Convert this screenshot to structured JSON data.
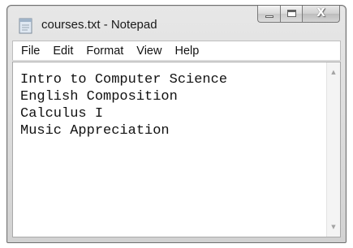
{
  "window": {
    "title": "courses.txt - Notepad",
    "close_glyph": "X"
  },
  "menu": {
    "items": [
      "File",
      "Edit",
      "Format",
      "View",
      "Help"
    ]
  },
  "editor": {
    "lines": [
      "Intro to Computer Science",
      "English Composition",
      "Calculus I",
      "Music Appreciation"
    ]
  },
  "scrollbar": {
    "up_glyph": "▲",
    "down_glyph": "▼"
  },
  "icons": {
    "app": "notepad-icon",
    "minimize": "minimize-icon",
    "maximize": "maximize-icon",
    "close": "close-icon"
  }
}
